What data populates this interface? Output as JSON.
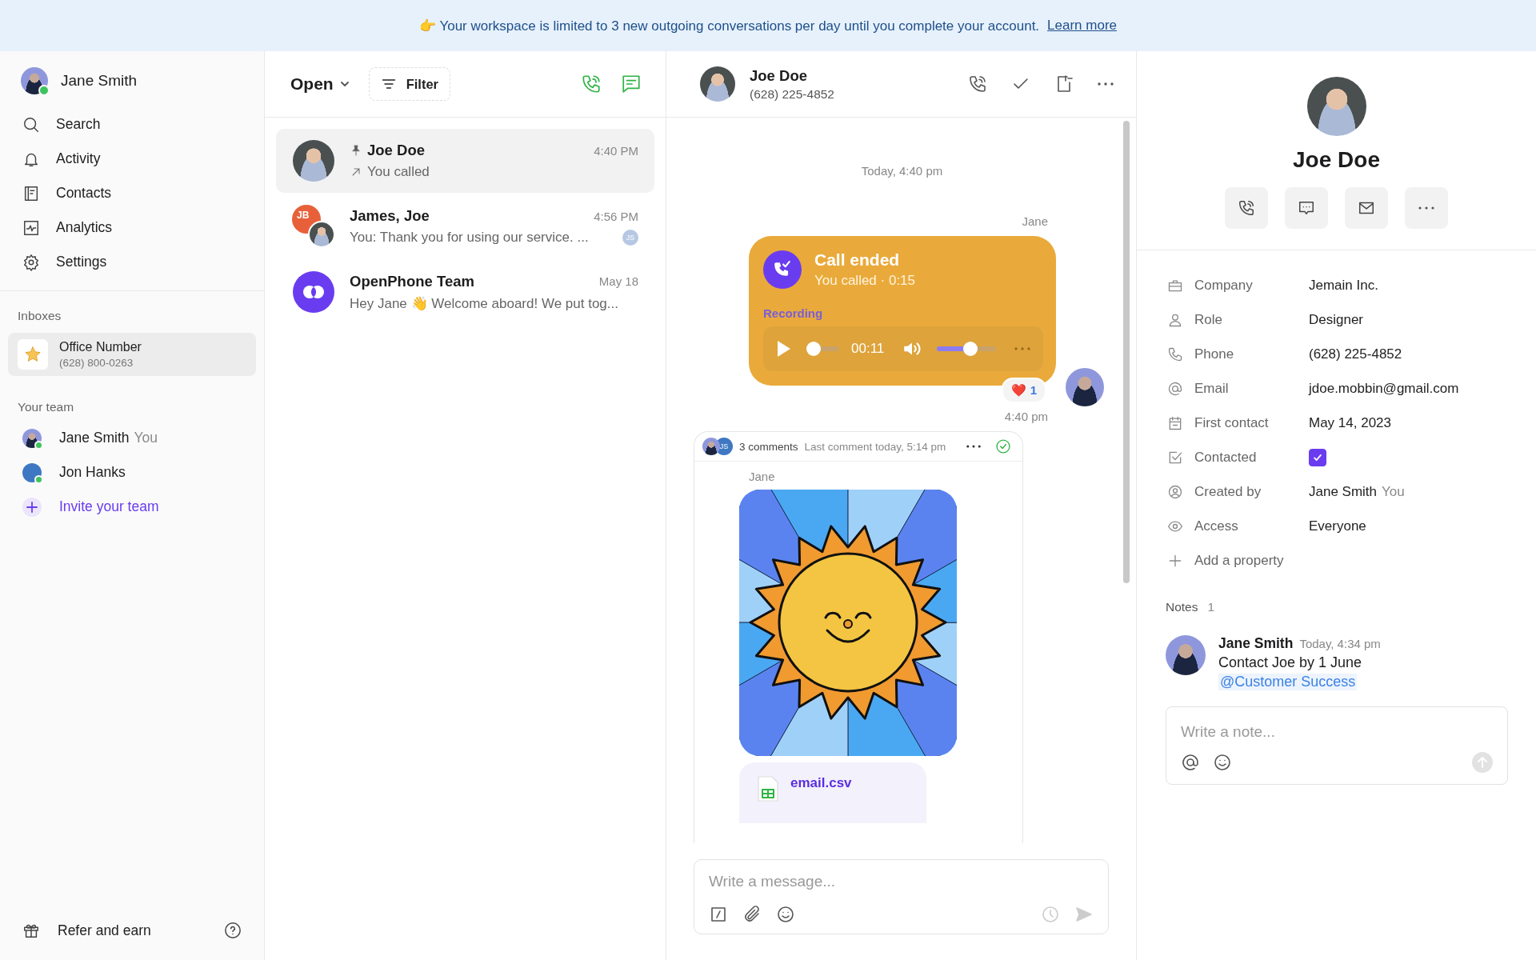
{
  "banner": {
    "emoji": "👉",
    "text": "Your workspace is limited to 3 new outgoing conversations per day until you complete your account.",
    "link": "Learn more"
  },
  "sidebar": {
    "user": {
      "name": "Jane Smith",
      "online": true
    },
    "nav": [
      {
        "label": "Search",
        "selected": false
      },
      {
        "label": "Activity",
        "selected": false
      },
      {
        "label": "Contacts",
        "selected": false
      },
      {
        "label": "Analytics",
        "selected": false
      },
      {
        "label": "Settings",
        "selected": false
      }
    ],
    "inboxes_title": "Inboxes",
    "inboxes": [
      {
        "name": "Office Number",
        "number": "(628) 800-0263",
        "selected": true
      }
    ],
    "team_title": "Your team",
    "team": [
      {
        "name": "Jane Smith",
        "suffix": "You",
        "online": true
      },
      {
        "name": "Jon Hanks",
        "online": true
      }
    ],
    "invite": "Invite your team",
    "footer": "Refer and earn"
  },
  "list": {
    "status": "Open",
    "filter": "Filter",
    "conversations": [
      {
        "kind": "single",
        "name": "Joe Doe",
        "time": "4:40 PM",
        "preview": "You called",
        "pinned": true,
        "outgoing": true,
        "selected": true
      },
      {
        "kind": "group",
        "initials": "JB",
        "name": "James, Joe",
        "time": "4:56 PM",
        "preview": "You: Thank you for using our service. ...",
        "seen_by": "JS",
        "pinned": false,
        "outgoing": false,
        "selected": false
      },
      {
        "kind": "brand",
        "name": "OpenPhone Team",
        "time": "May 18",
        "preview": "Hey Jane 👋 Welcome aboard! We put tog...",
        "pinned": false,
        "outgoing": false,
        "selected": false
      }
    ]
  },
  "chat": {
    "contact": {
      "name": "Joe Doe",
      "phone": "(628) 225-4852"
    },
    "day": "Today, 4:40 pm",
    "sender": "Jane",
    "call": {
      "title": "Call ended",
      "subtitle": "You called · 0:15",
      "recording_label": "Recording",
      "position": "00:11",
      "progress": {
        "level": 0
      },
      "volume": {
        "level": 0.6
      }
    },
    "reaction": {
      "emoji": "❤️",
      "count": "1"
    },
    "time": "4:40 pm",
    "thread": {
      "count": "3 comments",
      "last": "Last comment today, 5:14 pm",
      "resolved": true,
      "initials": "JS",
      "sender": "Jane",
      "file": "email.csv"
    },
    "composer": {
      "placeholder": "Write a message..."
    }
  },
  "contact": {
    "name": "Joe Doe",
    "properties": [
      {
        "label": "Company",
        "kind": "text",
        "value": "Jemain Inc."
      },
      {
        "label": "Role",
        "kind": "text",
        "value": "Designer"
      },
      {
        "label": "Phone",
        "kind": "text",
        "value": "(628) 225-4852"
      },
      {
        "label": "Email",
        "kind": "text",
        "value": "jdoe.mobbin@gmail.com"
      },
      {
        "label": "First contact",
        "kind": "text",
        "value": "May 14, 2023"
      },
      {
        "label": "Contacted",
        "kind": "checkbox",
        "checked": true
      },
      {
        "label": "Created by",
        "kind": "user",
        "value": "Jane Smith",
        "suffix": "You"
      },
      {
        "label": "Access",
        "kind": "text",
        "value": "Everyone"
      }
    ],
    "add": "Add a property",
    "notes_title": "Notes",
    "notes_count": "1",
    "notes": [
      {
        "author": "Jane Smith",
        "time": "Today, 4:34 pm",
        "text": "Contact Joe by 1 June",
        "mention": "@Customer Success"
      }
    ],
    "note_placeholder": "Write a note..."
  }
}
